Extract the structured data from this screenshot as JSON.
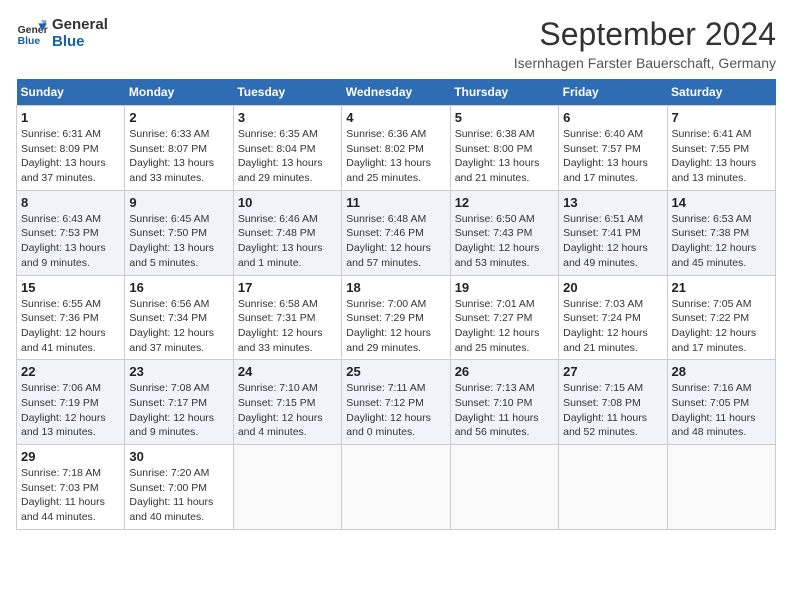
{
  "header": {
    "logo_line1": "General",
    "logo_line2": "Blue",
    "month_title": "September 2024",
    "location": "Isernhagen Farster Bauerschaft, Germany"
  },
  "weekdays": [
    "Sunday",
    "Monday",
    "Tuesday",
    "Wednesday",
    "Thursday",
    "Friday",
    "Saturday"
  ],
  "weeks": [
    [
      {
        "day": "1",
        "info": "Sunrise: 6:31 AM\nSunset: 8:09 PM\nDaylight: 13 hours\nand 37 minutes."
      },
      {
        "day": "2",
        "info": "Sunrise: 6:33 AM\nSunset: 8:07 PM\nDaylight: 13 hours\nand 33 minutes."
      },
      {
        "day": "3",
        "info": "Sunrise: 6:35 AM\nSunset: 8:04 PM\nDaylight: 13 hours\nand 29 minutes."
      },
      {
        "day": "4",
        "info": "Sunrise: 6:36 AM\nSunset: 8:02 PM\nDaylight: 13 hours\nand 25 minutes."
      },
      {
        "day": "5",
        "info": "Sunrise: 6:38 AM\nSunset: 8:00 PM\nDaylight: 13 hours\nand 21 minutes."
      },
      {
        "day": "6",
        "info": "Sunrise: 6:40 AM\nSunset: 7:57 PM\nDaylight: 13 hours\nand 17 minutes."
      },
      {
        "day": "7",
        "info": "Sunrise: 6:41 AM\nSunset: 7:55 PM\nDaylight: 13 hours\nand 13 minutes."
      }
    ],
    [
      {
        "day": "8",
        "info": "Sunrise: 6:43 AM\nSunset: 7:53 PM\nDaylight: 13 hours\nand 9 minutes."
      },
      {
        "day": "9",
        "info": "Sunrise: 6:45 AM\nSunset: 7:50 PM\nDaylight: 13 hours\nand 5 minutes."
      },
      {
        "day": "10",
        "info": "Sunrise: 6:46 AM\nSunset: 7:48 PM\nDaylight: 13 hours\nand 1 minute."
      },
      {
        "day": "11",
        "info": "Sunrise: 6:48 AM\nSunset: 7:46 PM\nDaylight: 12 hours\nand 57 minutes."
      },
      {
        "day": "12",
        "info": "Sunrise: 6:50 AM\nSunset: 7:43 PM\nDaylight: 12 hours\nand 53 minutes."
      },
      {
        "day": "13",
        "info": "Sunrise: 6:51 AM\nSunset: 7:41 PM\nDaylight: 12 hours\nand 49 minutes."
      },
      {
        "day": "14",
        "info": "Sunrise: 6:53 AM\nSunset: 7:38 PM\nDaylight: 12 hours\nand 45 minutes."
      }
    ],
    [
      {
        "day": "15",
        "info": "Sunrise: 6:55 AM\nSunset: 7:36 PM\nDaylight: 12 hours\nand 41 minutes."
      },
      {
        "day": "16",
        "info": "Sunrise: 6:56 AM\nSunset: 7:34 PM\nDaylight: 12 hours\nand 37 minutes."
      },
      {
        "day": "17",
        "info": "Sunrise: 6:58 AM\nSunset: 7:31 PM\nDaylight: 12 hours\nand 33 minutes."
      },
      {
        "day": "18",
        "info": "Sunrise: 7:00 AM\nSunset: 7:29 PM\nDaylight: 12 hours\nand 29 minutes."
      },
      {
        "day": "19",
        "info": "Sunrise: 7:01 AM\nSunset: 7:27 PM\nDaylight: 12 hours\nand 25 minutes."
      },
      {
        "day": "20",
        "info": "Sunrise: 7:03 AM\nSunset: 7:24 PM\nDaylight: 12 hours\nand 21 minutes."
      },
      {
        "day": "21",
        "info": "Sunrise: 7:05 AM\nSunset: 7:22 PM\nDaylight: 12 hours\nand 17 minutes."
      }
    ],
    [
      {
        "day": "22",
        "info": "Sunrise: 7:06 AM\nSunset: 7:19 PM\nDaylight: 12 hours\nand 13 minutes."
      },
      {
        "day": "23",
        "info": "Sunrise: 7:08 AM\nSunset: 7:17 PM\nDaylight: 12 hours\nand 9 minutes."
      },
      {
        "day": "24",
        "info": "Sunrise: 7:10 AM\nSunset: 7:15 PM\nDaylight: 12 hours\nand 4 minutes."
      },
      {
        "day": "25",
        "info": "Sunrise: 7:11 AM\nSunset: 7:12 PM\nDaylight: 12 hours\nand 0 minutes."
      },
      {
        "day": "26",
        "info": "Sunrise: 7:13 AM\nSunset: 7:10 PM\nDaylight: 11 hours\nand 56 minutes."
      },
      {
        "day": "27",
        "info": "Sunrise: 7:15 AM\nSunset: 7:08 PM\nDaylight: 11 hours\nand 52 minutes."
      },
      {
        "day": "28",
        "info": "Sunrise: 7:16 AM\nSunset: 7:05 PM\nDaylight: 11 hours\nand 48 minutes."
      }
    ],
    [
      {
        "day": "29",
        "info": "Sunrise: 7:18 AM\nSunset: 7:03 PM\nDaylight: 11 hours\nand 44 minutes."
      },
      {
        "day": "30",
        "info": "Sunrise: 7:20 AM\nSunset: 7:00 PM\nDaylight: 11 hours\nand 40 minutes."
      },
      null,
      null,
      null,
      null,
      null
    ]
  ]
}
